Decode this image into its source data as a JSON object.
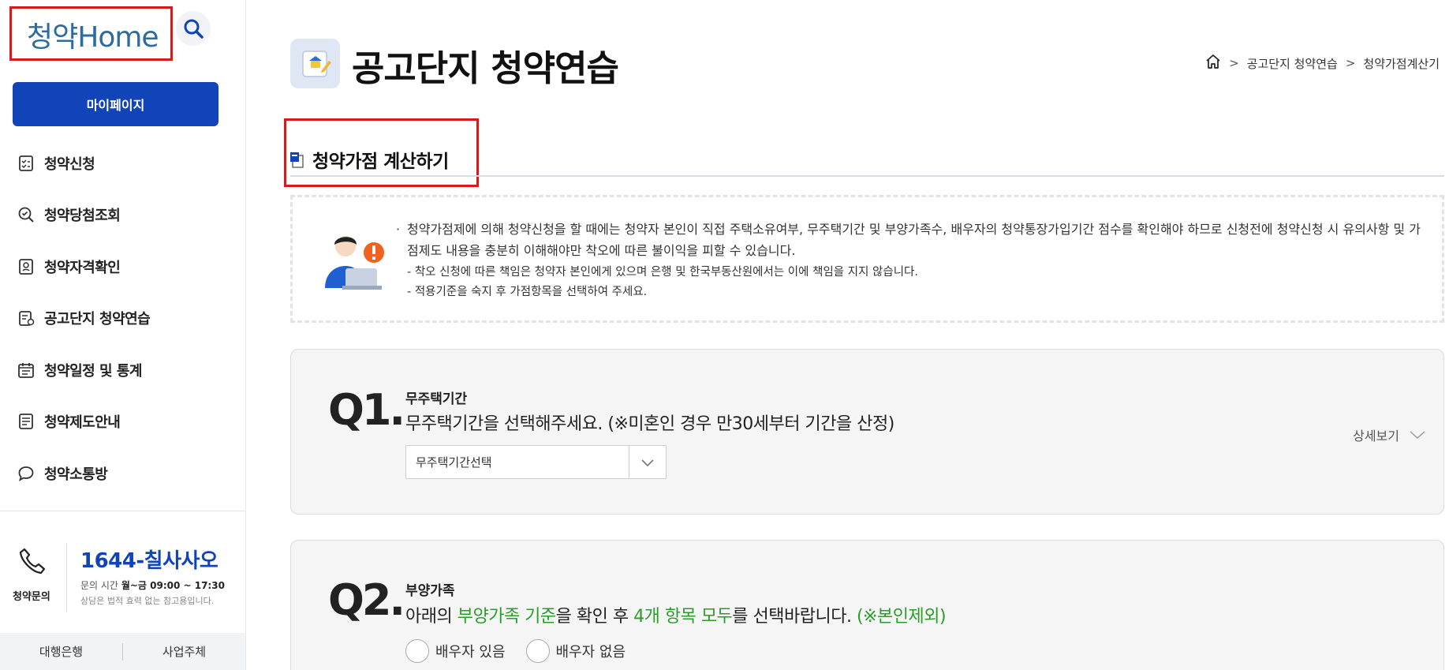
{
  "sidebar": {
    "logo": {
      "prefix": "청약",
      "suffix": "Home"
    },
    "mypage_label": "마이페이지",
    "nav": [
      {
        "label": "청약신청",
        "icon": "checklist-icon"
      },
      {
        "label": "청약당첨조회",
        "icon": "search-check-icon"
      },
      {
        "label": "청약자격확인",
        "icon": "id-card-icon"
      },
      {
        "label": "공고단지 청약연습",
        "icon": "practice-icon"
      },
      {
        "label": "청약일정 및 통계",
        "icon": "calendar-icon"
      },
      {
        "label": "청약제도안내",
        "icon": "document-icon"
      },
      {
        "label": "청약소통방",
        "icon": "chat-bubble-icon"
      }
    ],
    "contact": {
      "label": "청약문의",
      "number": "1644-칠사사오",
      "hours_label": "문의 시간",
      "hours_value": "월~금 09:00 ~ 17:30",
      "note": "상담은 법적 효력 없는 참고용입니다."
    },
    "bottom": {
      "left": "대행은행",
      "right": "사업주체"
    }
  },
  "header": {
    "title": "공고단지 청약연습",
    "breadcrumb": [
      "공고단지 청약연습",
      "청약가점계산기"
    ]
  },
  "section": {
    "title": "청약가점 계산하기"
  },
  "notice": {
    "main": "청약가점제에 의해 청약신청을 할 때에는 청약자 본인이 직접 주택소유여부, 무주택기간 및 부양가족수, 배우자의 청약통장가입기간 점수를 확인해야 하므로 신청전에 청약신청 시 유의사항 및 가점제도 내용을 충분히 이해해야만 착오에 따른 불이익을 피할 수 있습니다.",
    "sub1": "- 착오 신청에 따른 책임은 청약자 본인에게 있으며 은행 및 한국부동산원에서는 이에 책임을 지지 않습니다.",
    "sub2": "- 적용기준을 숙지 후 가점항목을 선택하여 주세요."
  },
  "q1": {
    "num": "Q1.",
    "sub": "무주택기간",
    "text": "무주택기간을 선택해주세요. (※미혼인 경우 만30세부터 기간을 산정)",
    "select_value": "무주택기간선택",
    "detail_label": "상세보기"
  },
  "q2": {
    "num": "Q2.",
    "sub": "부양가족",
    "text_parts": [
      "아래의 ",
      "부양가족 기준",
      "을 확인 후 ",
      "4개 항목 모두",
      "를 선택바랍니다. ",
      "(※본인제외)"
    ],
    "radio1": "배우자 있음",
    "radio2": "배우자 없음"
  },
  "colors": {
    "primary": "#1244b9",
    "highlight_box": "#d41c1c",
    "green": "#2a9d2a"
  }
}
